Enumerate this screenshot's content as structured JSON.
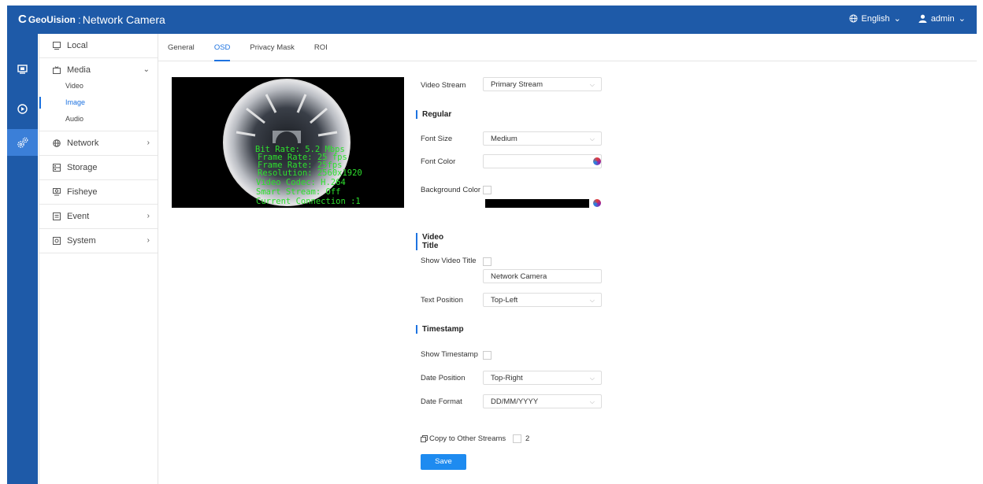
{
  "header": {
    "logo_mark": "C",
    "brand": "GeoUision",
    "sep": ":",
    "title": "Network Camera",
    "language": "English",
    "user": "admin"
  },
  "sidebar": {
    "local": "Local",
    "media": "Media",
    "media_sub": [
      "Video",
      "Image",
      "Audio"
    ],
    "network": "Network",
    "storage": "Storage",
    "fisheye": "Fisheye",
    "event": "Event",
    "system": "System"
  },
  "tabs": [
    "General",
    "OSD",
    "Privacy Mask",
    "ROI"
  ],
  "preview": {
    "osd_lines": [
      "Bit Rate: 5.2 Mbps",
      "Frame Rate: 25 fps",
      "Frame Rate: 25fps",
      "Resolution: 2560x1920",
      "Video Codec: H.264",
      "Smart Stream: Off",
      "Current Connection :1"
    ]
  },
  "form": {
    "video_stream_label": "Video Stream",
    "video_stream_value": "Primary Stream",
    "regular_title": "Regular",
    "font_size_label": "Font Size",
    "font_size_value": "Medium",
    "font_color_label": "Font Color",
    "background_color_label": "Background Color",
    "video_title_section": "Video Title",
    "show_video_title_label": "Show Video Title",
    "video_title_value": "Network Camera",
    "text_position_label": "Text Position",
    "text_position_value": "Top-Left",
    "timestamp_section": "Timestamp",
    "show_timestamp_label": "Show Timestamp",
    "date_position_label": "Date Position",
    "date_position_value": "Top-Right",
    "date_format_label": "Date Format",
    "date_format_value": "DD/MM/YYYY",
    "copy_label": "Copy to Other Streams",
    "copy_stream": "2",
    "save_label": "Save"
  },
  "colors": {
    "accent": "#1e73e0",
    "header": "#1e5aa8",
    "osd_text": "#2ee02e"
  }
}
